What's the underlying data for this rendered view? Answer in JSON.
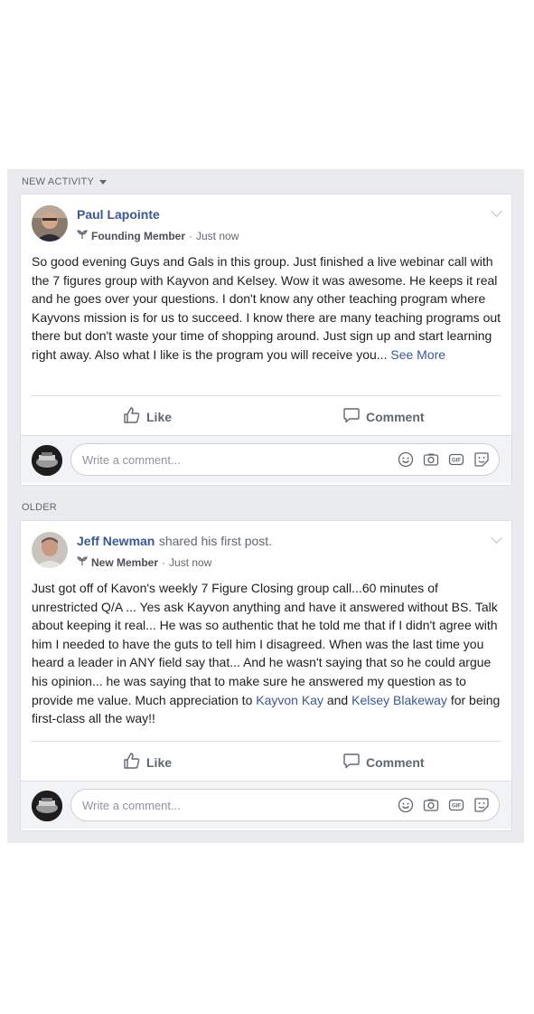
{
  "sections": {
    "new_activity": "NEW ACTIVITY",
    "older": "OLDER"
  },
  "posts": [
    {
      "author": "Paul Lapointe",
      "shared_text": "",
      "badge": "Founding Member",
      "time": "Just now",
      "body": "So good evening Guys and Gals in this group. Just finished a live webinar call with the 7 figures group with Kayvon and Kelsey. Wow it was awesome. He keeps it real and he goes over your questions. I don't know any other teaching program where Kayvons mission is for us to succeed. I know there are many teaching programs out there but don't waste your time of shopping around. Just sign up and start learning right away. Also what I like is the program you will receive you...",
      "see_more": "See More",
      "like": "Like",
      "comment": "Comment",
      "comment_placeholder": "Write a comment..."
    },
    {
      "author": "Jeff Newman",
      "shared_text": "shared his first post.",
      "badge": "New Member",
      "time": "Just now",
      "body_part1": "Just got off of Kavon's weekly 7 Figure Closing group call...60 minutes of unrestricted Q/A ... Yes ask Kayvon anything and have it answered without BS. Talk about keeping it real... He was so authentic that he told me that if I didn't agree with him I needed to have the guts to tell him I disagreed. When was the last time you heard a leader in ANY field say that... And he wasn't saying that so he could argue his opinion... he was saying that to make sure he answered my question as to provide me value. Much appreciation to",
      "mention1": "Kayvon Kay",
      "and_text": "and",
      "mention2": "Kelsey Blakeway",
      "body_part2": "for being first-class all the way!!",
      "like": "Like",
      "comment": "Comment",
      "comment_placeholder": "Write a comment..."
    }
  ],
  "colors": {
    "link": "#385898",
    "feed_bg": "#e9ebee",
    "muted": "#606770"
  },
  "icons": [
    "sprout-icon",
    "member-icon",
    "like-icon",
    "comment-icon",
    "emoji-icon",
    "camera-icon",
    "gif-icon",
    "sticker-icon",
    "chevron-down-icon"
  ]
}
